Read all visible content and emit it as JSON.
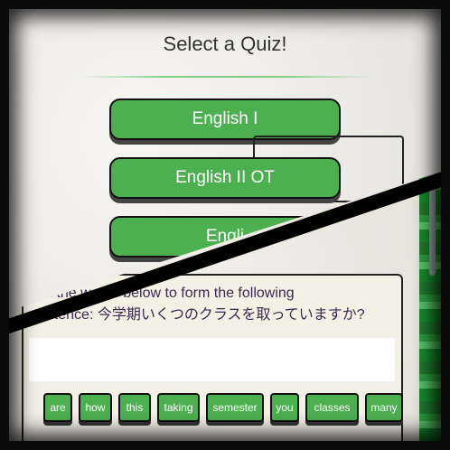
{
  "quiz_menu": {
    "title": "Select a Quiz!",
    "options": [
      {
        "label": "English I"
      },
      {
        "label": "English II OT"
      },
      {
        "label": "Engli"
      }
    ]
  },
  "exercise": {
    "instruction_line1": "…k the words below to form the following",
    "instruction_line2": "sentence: 今学期いくつのクラスを取っていますか?",
    "answer_value": "",
    "word_bank": [
      "are",
      "how",
      "this",
      "taking",
      "semester",
      "you",
      "classes",
      "many"
    ]
  },
  "colors": {
    "button_green": "#4caf50",
    "border": "#111111",
    "instruction_text": "#3a2a4e"
  }
}
